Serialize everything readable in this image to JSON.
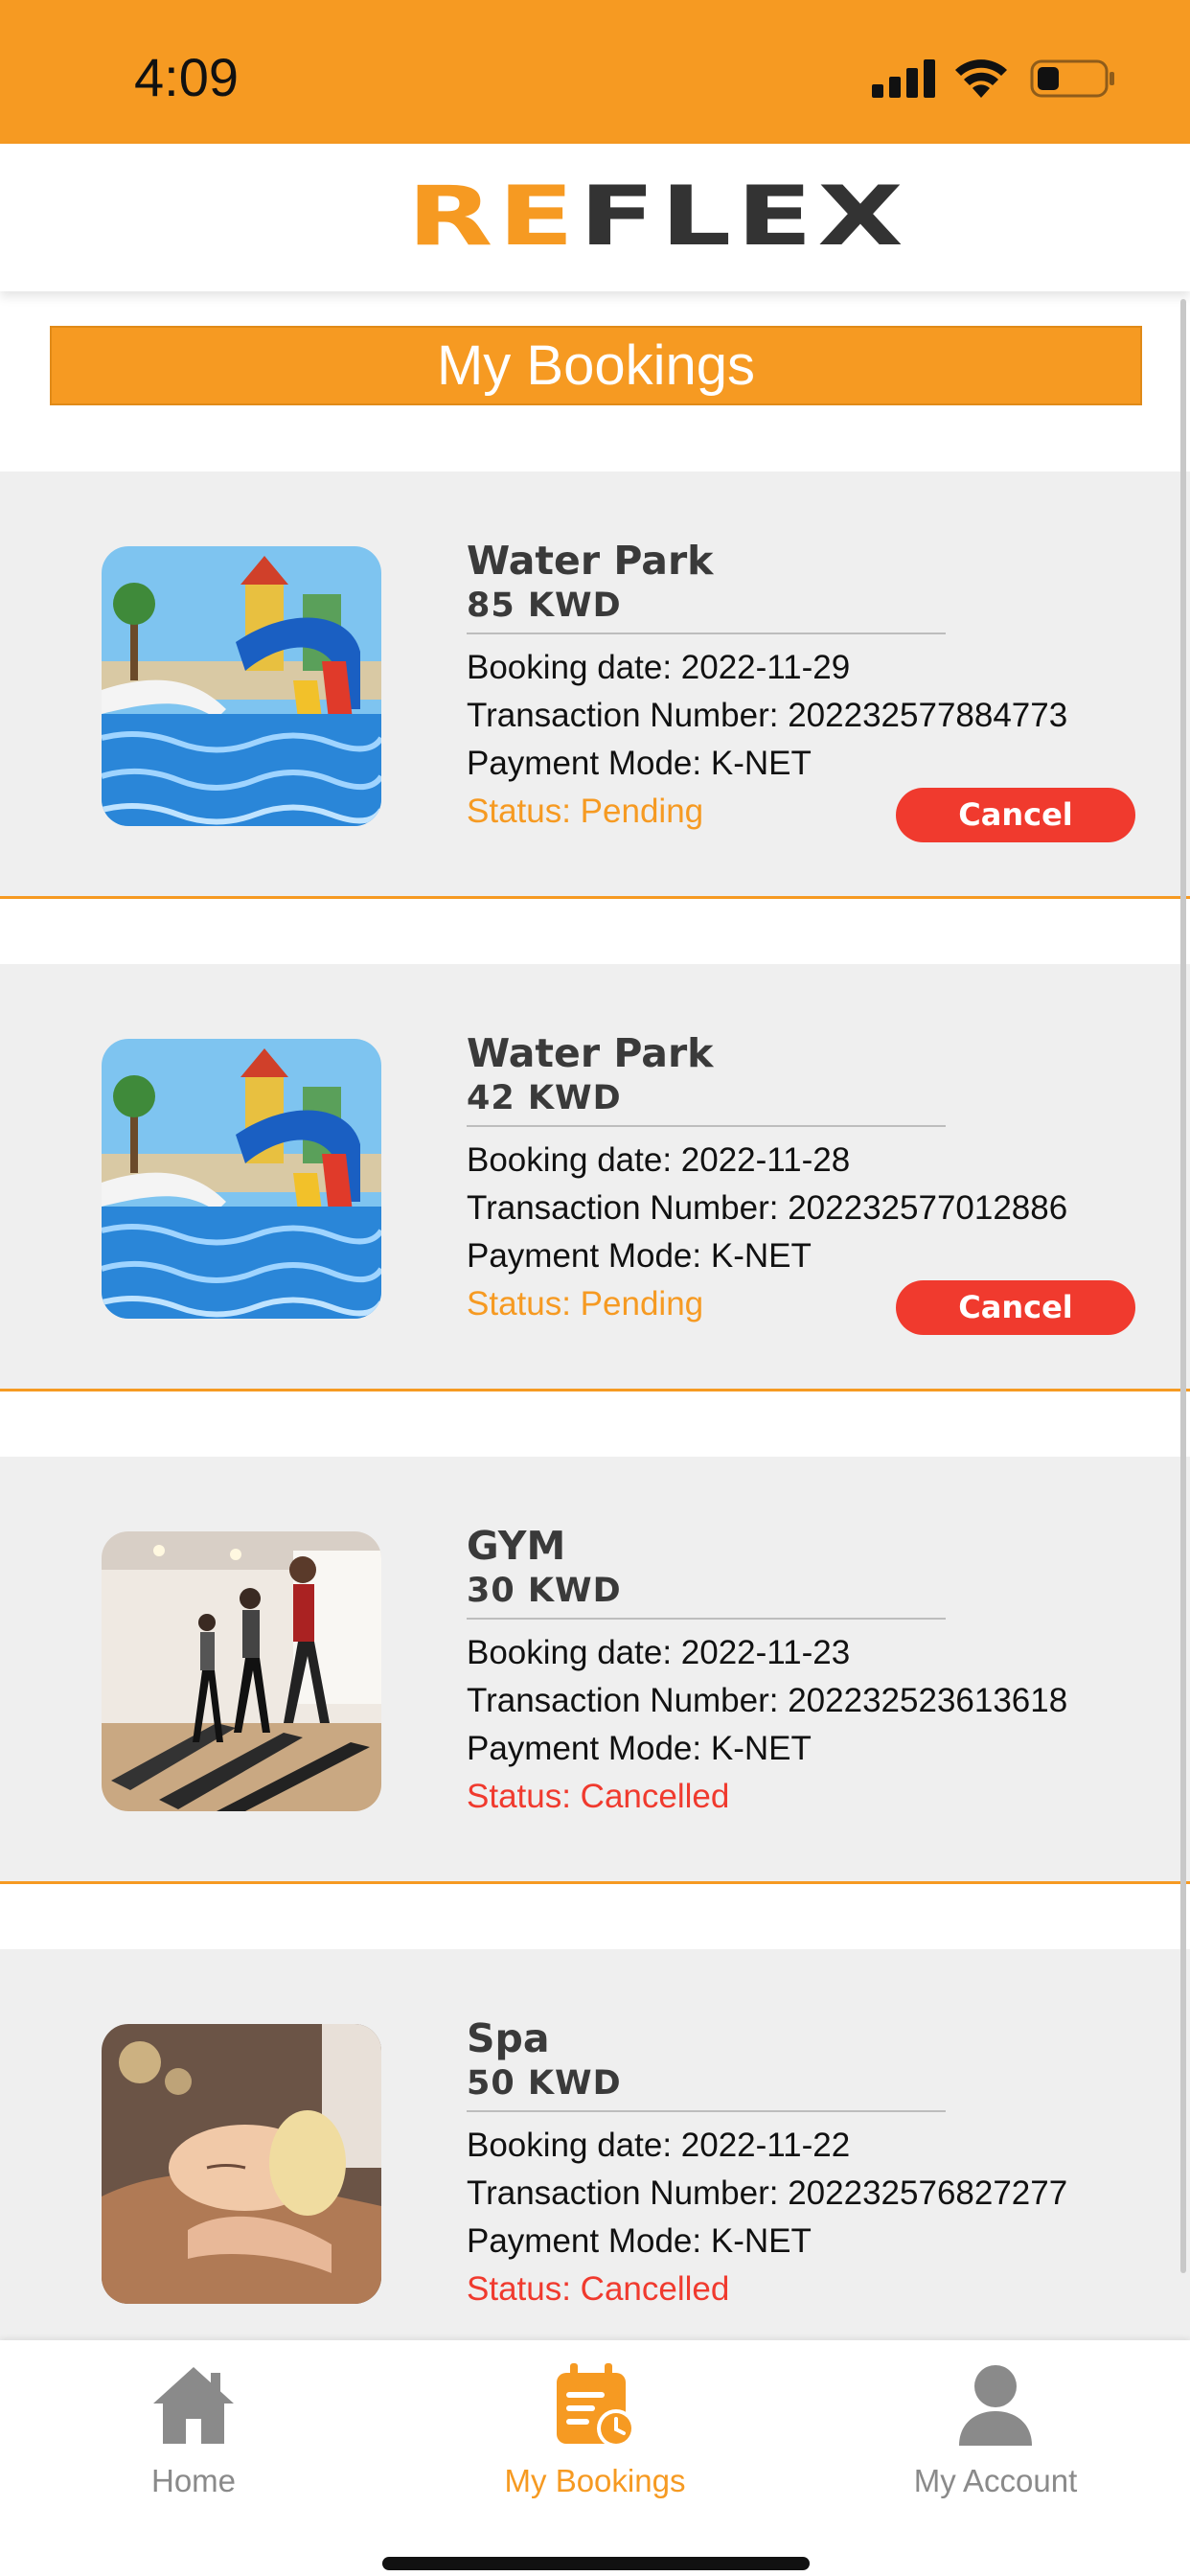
{
  "status_bar": {
    "time": "4:09"
  },
  "header": {
    "logo_accent": "RE",
    "logo_rest": "FLEX"
  },
  "page_title": "My Bookings",
  "colors": {
    "accent": "#F69A22",
    "danger": "#F03A2E",
    "card_bg": "#EFEFEF"
  },
  "bookings": [
    {
      "name": "Water Park",
      "price": "85 KWD",
      "booking_date": "Booking date: 2022-11-29",
      "transaction": "Transaction Number: 202232577884773",
      "payment": "Payment Mode: K-NET",
      "status": "Status: Pending",
      "image": "water-park",
      "action": "Cancel"
    },
    {
      "name": "Water Park",
      "price": "42 KWD",
      "booking_date": "Booking date: 2022-11-28",
      "transaction": "Transaction Number: 202232577012886",
      "payment": "Payment Mode: K-NET",
      "status": "Status: Pending",
      "image": "water-park",
      "action": "Cancel"
    },
    {
      "name": "GYM",
      "price": "30 KWD",
      "booking_date": "Booking date: 2022-11-23",
      "transaction": "Transaction Number: 202232523613618",
      "payment": "Payment Mode: K-NET",
      "status": "Status: Cancelled",
      "image": "gym"
    },
    {
      "name": "Spa",
      "price": "50 KWD",
      "booking_date": "Booking date: 2022-11-22",
      "transaction": "Transaction Number: 202232576827277",
      "payment": "Payment Mode: K-NET",
      "status": "Status: Cancelled",
      "image": "spa"
    }
  ],
  "tabs": [
    {
      "label": "Home",
      "icon": "home-icon",
      "active": false
    },
    {
      "label": "My Bookings",
      "icon": "bookings-icon",
      "active": true
    },
    {
      "label": "My Account",
      "icon": "account-icon",
      "active": false
    }
  ]
}
